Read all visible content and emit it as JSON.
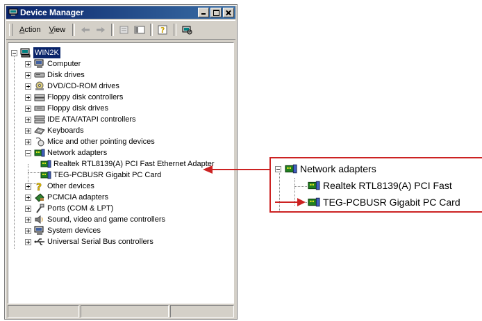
{
  "window": {
    "title": "Device Manager"
  },
  "toolbar": {
    "menus": [
      {
        "label": "Action",
        "accel": "A"
      },
      {
        "label": "View",
        "accel": "V"
      }
    ],
    "icons": [
      "back-arrow-icon",
      "forward-arrow-icon",
      "properties-icon",
      "console-tree-icon",
      "help-icon",
      "scan-hardware-icon"
    ]
  },
  "tree": {
    "root": "WIN2K",
    "categories": [
      {
        "label": "Computer",
        "icon": "computer-icon",
        "expanded": false
      },
      {
        "label": "Disk drives",
        "icon": "disk-drive-icon",
        "expanded": false
      },
      {
        "label": "DVD/CD-ROM drives",
        "icon": "cdrom-icon",
        "expanded": false
      },
      {
        "label": "Floppy disk controllers",
        "icon": "controller-icon",
        "expanded": false
      },
      {
        "label": "Floppy disk drives",
        "icon": "floppy-icon",
        "expanded": false
      },
      {
        "label": "IDE ATA/ATAPI controllers",
        "icon": "ide-controller-icon",
        "expanded": false
      },
      {
        "label": "Keyboards",
        "icon": "keyboard-icon",
        "expanded": false
      },
      {
        "label": "Mice and other pointing devices",
        "icon": "mouse-icon",
        "expanded": false
      },
      {
        "label": "Network adapters",
        "icon": "network-adapter-icon",
        "expanded": true,
        "children": [
          "Realtek RTL8139(A) PCI Fast Ethernet Adapter",
          "TEG-PCBUSR Gigabit PC Card"
        ]
      },
      {
        "label": "Other devices",
        "icon": "question-icon",
        "expanded": false
      },
      {
        "label": "PCMCIA adapters",
        "icon": "pcmcia-icon",
        "expanded": false
      },
      {
        "label": "Ports (COM & LPT)",
        "icon": "port-icon",
        "expanded": false
      },
      {
        "label": "Sound, video and game controllers",
        "icon": "sound-icon",
        "expanded": false
      },
      {
        "label": "System devices",
        "icon": "system-icon",
        "expanded": false
      },
      {
        "label": "Universal Serial Bus controllers",
        "icon": "usb-icon",
        "expanded": false
      }
    ]
  },
  "callout": {
    "parent": "Network adapters",
    "children": [
      "Realtek RTL8139(A) PCI Fast",
      "TEG-PCBUSR Gigabit PC Card"
    ],
    "accent": "#cc2222"
  }
}
